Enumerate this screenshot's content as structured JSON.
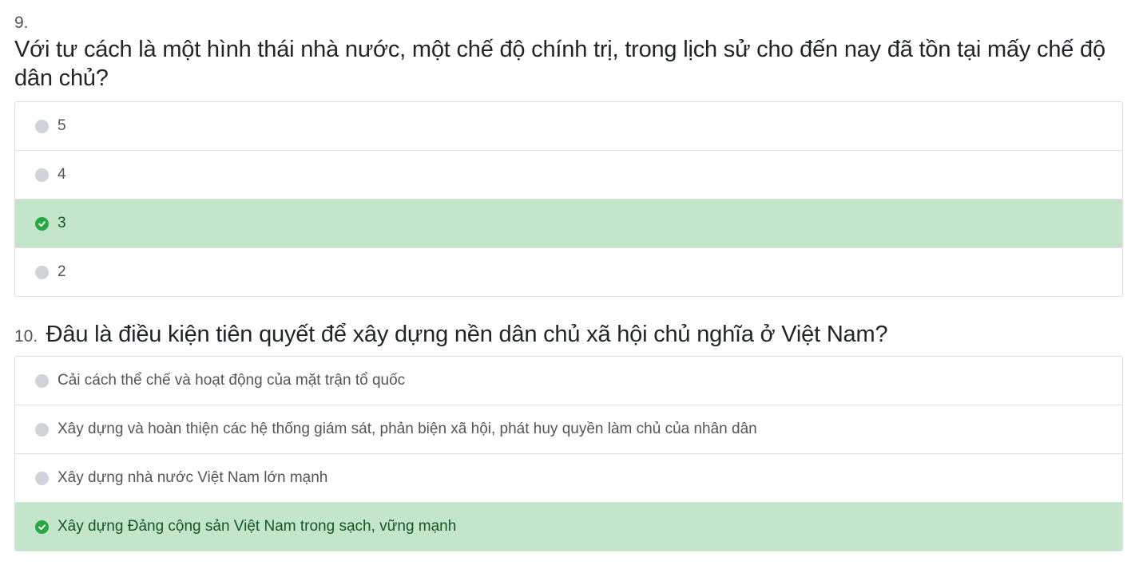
{
  "questions": [
    {
      "number": "9.",
      "text": "Với tư cách là một hình thái nhà nước, một chế độ chính trị, trong lịch sử cho đến nay đã tồn tại mấy chế độ dân chủ?",
      "options": [
        {
          "label": "5",
          "correct": false
        },
        {
          "label": "4",
          "correct": false
        },
        {
          "label": "3",
          "correct": true
        },
        {
          "label": "2",
          "correct": false
        }
      ]
    },
    {
      "number": "10.",
      "text": "Đâu là điều kiện tiên quyết để xây dựng nền dân chủ xã hội chủ nghĩa ở Việt Nam?",
      "options": [
        {
          "label": "Cải cách thể chế và hoạt động của mặt trận tổ quốc",
          "correct": false
        },
        {
          "label": "Xây dựng và hoàn thiện các hệ thống giám sát, phản biện xã hội, phát huy quyền làm chủ của nhân dân",
          "correct": false
        },
        {
          "label": "Xây dựng nhà nước Việt Nam lớn mạnh",
          "correct": false
        },
        {
          "label": "Xây dựng Đảng cộng sản Việt Nam trong sạch, vững mạnh",
          "correct": true
        }
      ]
    }
  ],
  "colors": {
    "correct_bg": "#c3e6cb",
    "correct_icon": "#28a745",
    "radio_idle": "#ced4da",
    "border": "#dee2e6"
  },
  "icons": {
    "correct": "check-circle-icon",
    "idle": "radio-icon"
  }
}
